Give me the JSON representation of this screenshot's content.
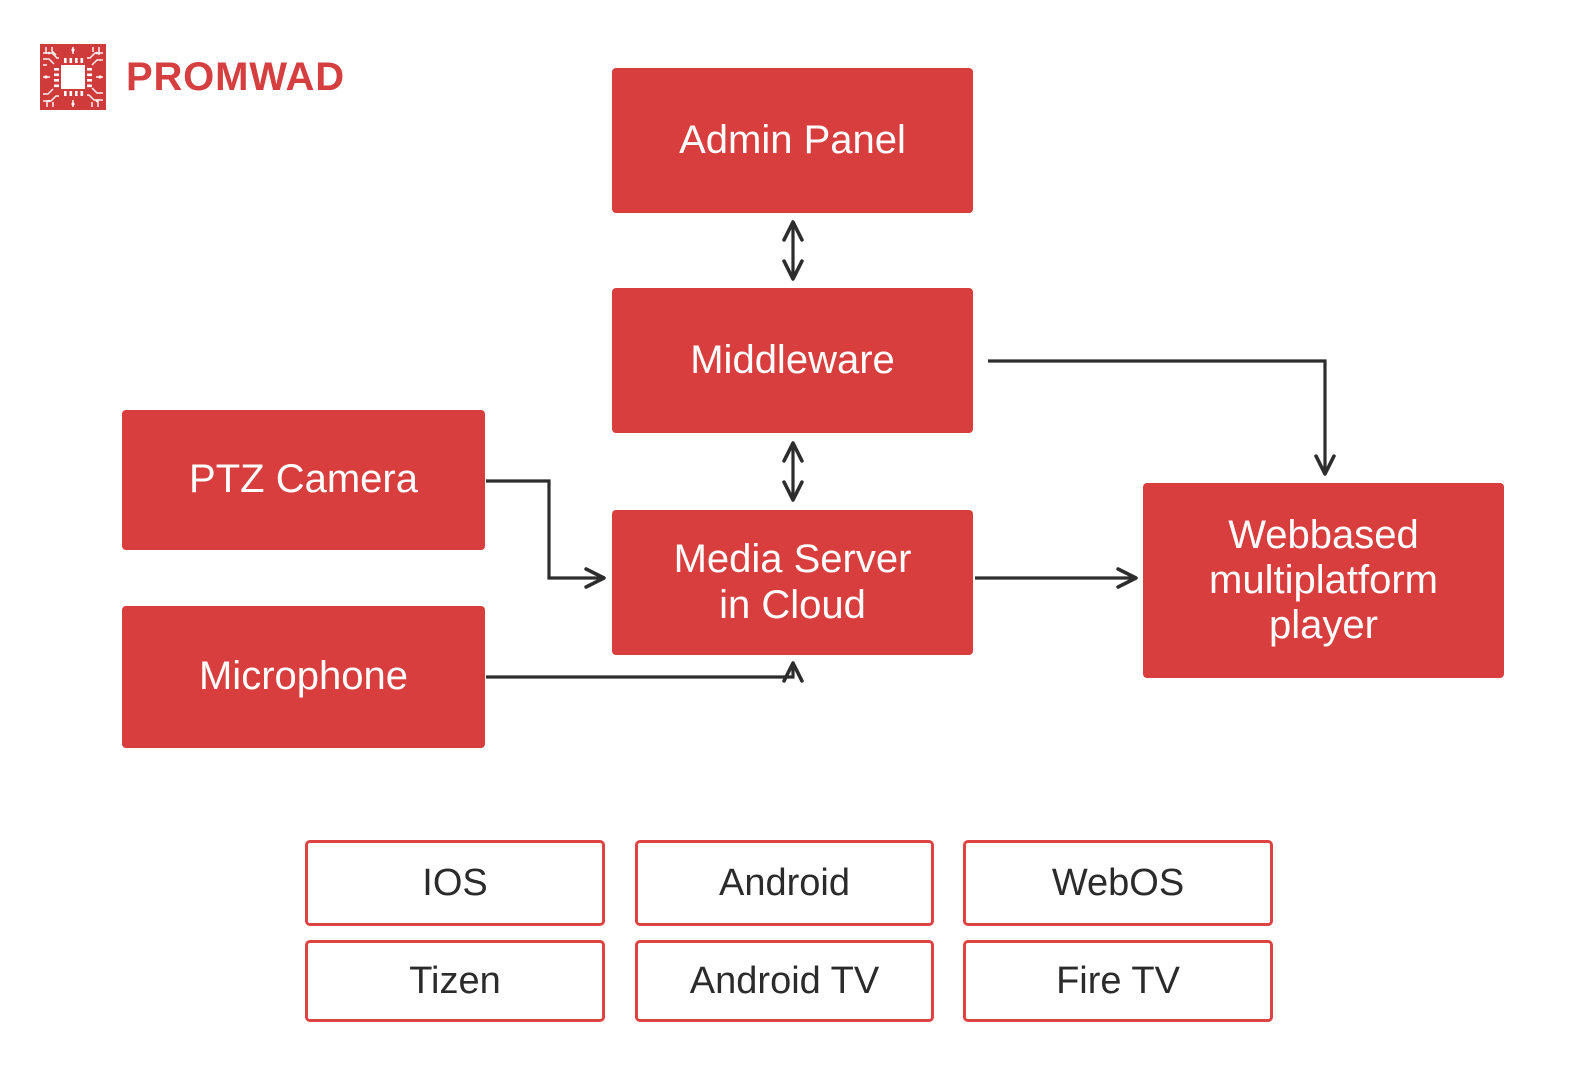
{
  "brand": {
    "name": "PROMWAD",
    "logo_icon": "pcb-chip-icon",
    "color": "#d63f3f"
  },
  "theme": {
    "node_fill": "#d93e3e",
    "node_text": "#ffffff",
    "chip_border": "#de4343",
    "chip_fill": "#ffffff",
    "chip_text": "#2b2b2b",
    "connector": "#2d2d2d",
    "background": "#ffffff"
  },
  "diagram": {
    "nodes": {
      "admin_panel": "Admin Panel",
      "middleware": "Middleware",
      "media_server_line1": "Media Server",
      "media_server_line2": "in Cloud",
      "ptz_camera": "PTZ Camera",
      "microphone": "Microphone",
      "player_line1": "Webbased",
      "player_line2": "multiplatform",
      "player_line3": "player"
    },
    "connections": [
      {
        "from": "Admin Panel",
        "to": "Middleware",
        "direction": "bidirectional"
      },
      {
        "from": "Middleware",
        "to": "Media Server in Cloud",
        "direction": "bidirectional"
      },
      {
        "from": "PTZ Camera",
        "to": "Media Server in Cloud",
        "direction": "forward"
      },
      {
        "from": "Microphone",
        "to": "Media Server in Cloud",
        "direction": "forward"
      },
      {
        "from": "Media Server in Cloud",
        "to": "Webbased multiplatform player",
        "direction": "forward"
      },
      {
        "from": "Webbased multiplatform player",
        "to": "Middleware",
        "direction": "forward"
      }
    ]
  },
  "platforms": {
    "row1": [
      "IOS",
      "Android",
      "WebOS"
    ],
    "row2": [
      "Tizen",
      "Android TV",
      "Fire TV"
    ]
  }
}
